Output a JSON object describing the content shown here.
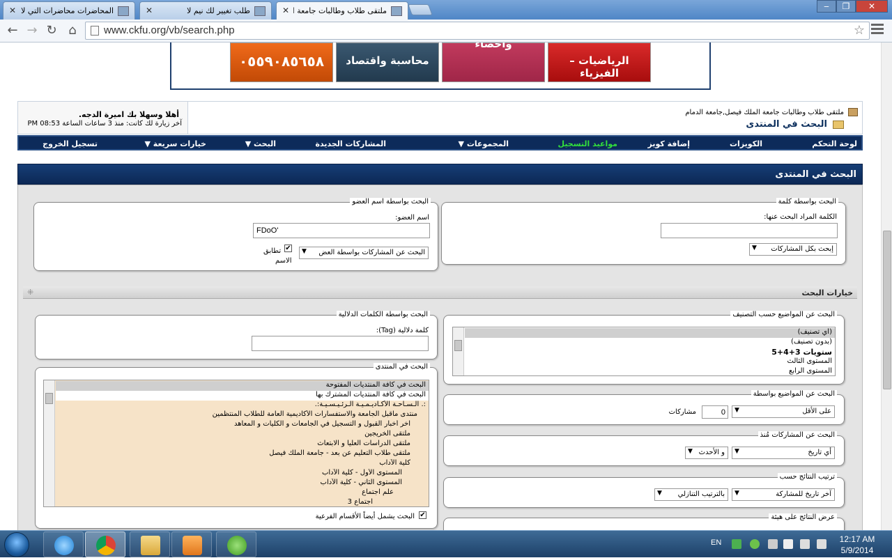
{
  "browser": {
    "tabs": [
      {
        "title": "المحاضرات محاضرات التي لا ت"
      },
      {
        "title": "طلب تغيير لك نيم لا"
      },
      {
        "title": "ملتقى طلاب وطالبات جامعة الم"
      }
    ],
    "url": "www.ckfu.org/vb/search.php"
  },
  "banner": {
    "items": [
      "الرياضيات – الفيزياء",
      "واحصاء",
      "محاسبة واقتصاد",
      "٠٥٥٩٠٨٥٦٥٨"
    ]
  },
  "userbar": {
    "breadcrumb": "ملتقى طلاب وطالبات جامعة الملك فيصل,جامعة الدمام",
    "page_title": "البحث في المنتدى",
    "welcome": "أهلا وسهلا بك اميرة الدجه.",
    "last_visit": "آخر زيارة لك كانت: منذ 3 ساعات الساعة 08:53 PM"
  },
  "navbar": {
    "items": [
      "لوحة التحكم",
      "الكويزات",
      "إضافة كويز",
      "مواعيد التسجيل",
      "المجموعات",
      "المشاركات الجديدة",
      "البحث",
      "خيارات سريعة",
      "تسجيل الخروج"
    ]
  },
  "colors": {
    "navbar_bg": "#0d2b5a",
    "highlight_green": "#32e03c",
    "header_bg": "#163e76"
  },
  "search": {
    "header": "البحث في المنتدى",
    "by_keyword": {
      "legend": "البحث بواسطة كلمة",
      "label": "الكلمة المراد البحث عنها:",
      "value": "",
      "scope_selected": "إبحث بكل المشاركات"
    },
    "by_user": {
      "legend": "البحث بواسطة اسم العضو",
      "label": "اسم العضو:",
      "value": "FDoO'",
      "mode_selected": "البحث عن المشاركات بواسطة العض",
      "exact_label_1": "تطابق",
      "exact_label_2": "الاسم",
      "exact_checked": true
    },
    "options_title": "خيارات البحث",
    "by_tag": {
      "legend": "البحث بواسطة الكلمات الدلالية",
      "label": "كلمة دلالية (Tag):",
      "value": ""
    },
    "by_prefix": {
      "legend": "البحث عن المواضيع حسب التصنيف",
      "items": [
        "(أي تصنيف)",
        "(بدون تصنيف)",
        "ستويات 3+4+5",
        "المستوى الثالث",
        "المستوى الرابع"
      ]
    },
    "in_forum": {
      "legend": "البحث في المنتدى",
      "items": [
        "البحث في كافة المنتديات المفتوحة",
        "البحث في كافة المنتديات المشترك بها",
        ":. الـسـاحـة الأكـاديـمـيـة الـرئـيـسـيـة:.",
        "منتدى ماقبل الجامعة والاستفسارات الأكاديمية العامة للطلاب المنتظمين",
        "آخر أخبار القبول و التسجيل في الجامعات و الكليات و المعاهد",
        "ملتقى الخريجين",
        "ملتقى الدراسات العليا و الابتعاث",
        "ملتقى طلاب التعليم عن بعد - جامعة الملك فيصل",
        "كلية الآداب",
        "المستوى الأول - كلية الآداب",
        "المستوى الثاني - كلية الآداب",
        "علم اجتماع",
        "اجتماع 3"
      ],
      "child_label": "البحث يشمل أيضاً الأقسام الفرعية",
      "child_checked": true
    },
    "by_replies": {
      "legend": "البحث عن المواضيع بواسطة",
      "mode_selected": "على الأقل",
      "value": "0",
      "unit": "مشاركات"
    },
    "by_date": {
      "legend": "البحث عن المشاركات مُنذ",
      "date_selected": "أي تاريخ",
      "dir_selected": "و الأحدث"
    },
    "sort": {
      "legend": "ترتيب النتائج حسب",
      "field_selected": "آخر تاريخ للمشاركة",
      "order_selected": "بالترتيب التنازلي"
    },
    "display": {
      "legend": "عرض النتائج على هيئة"
    }
  },
  "taskbar": {
    "lang": "EN",
    "time": "12:17 AM",
    "date": "5/9/2014"
  }
}
